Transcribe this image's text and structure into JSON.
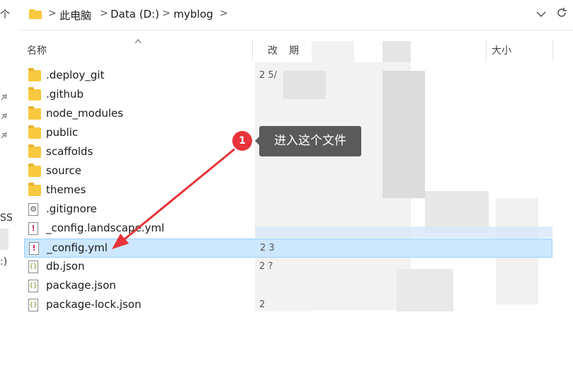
{
  "breadcrumb": {
    "items": [
      "此电脑",
      "Data (D:)",
      "myblog"
    ],
    "separator": ">"
  },
  "left_pane": {
    "partial_labels": [
      "个",
      "SS",
      ":)"
    ]
  },
  "columns": {
    "name": "名称",
    "date_partial": [
      "改",
      "期"
    ],
    "size": "大小"
  },
  "files": [
    {
      "name": ".deploy_git",
      "type": "folder",
      "date_partial": "2  5/"
    },
    {
      "name": ".github",
      "type": "folder",
      "date_partial": ""
    },
    {
      "name": "node_modules",
      "type": "folder",
      "date_partial": ""
    },
    {
      "name": "public",
      "type": "folder",
      "date_partial": ""
    },
    {
      "name": "scaffolds",
      "type": "folder",
      "date_partial": ""
    },
    {
      "name": "source",
      "type": "folder",
      "date_partial": ""
    },
    {
      "name": "themes",
      "type": "folder",
      "date_partial": ""
    },
    {
      "name": ".gitignore",
      "type": "gitignore",
      "date_partial": ""
    },
    {
      "name": "_config.landscape.yml",
      "type": "yml",
      "date_partial": ""
    },
    {
      "name": "_config.yml",
      "type": "yml",
      "date_partial": "2  3",
      "selected": true
    },
    {
      "name": "db.json",
      "type": "json",
      "date_partial": "2  ?"
    },
    {
      "name": "package.json",
      "type": "json",
      "date_partial": ""
    },
    {
      "name": "package-lock.json",
      "type": "json",
      "date_partial": "2"
    }
  ],
  "annotation": {
    "badge": "1",
    "text": "进入这个文件"
  },
  "colors": {
    "selected_row": "#cce8ff",
    "badge": "#e8333a",
    "arrow": "#e8333a",
    "tooltip_bg": "#5a5a5a",
    "folder": "#f8c93f"
  }
}
